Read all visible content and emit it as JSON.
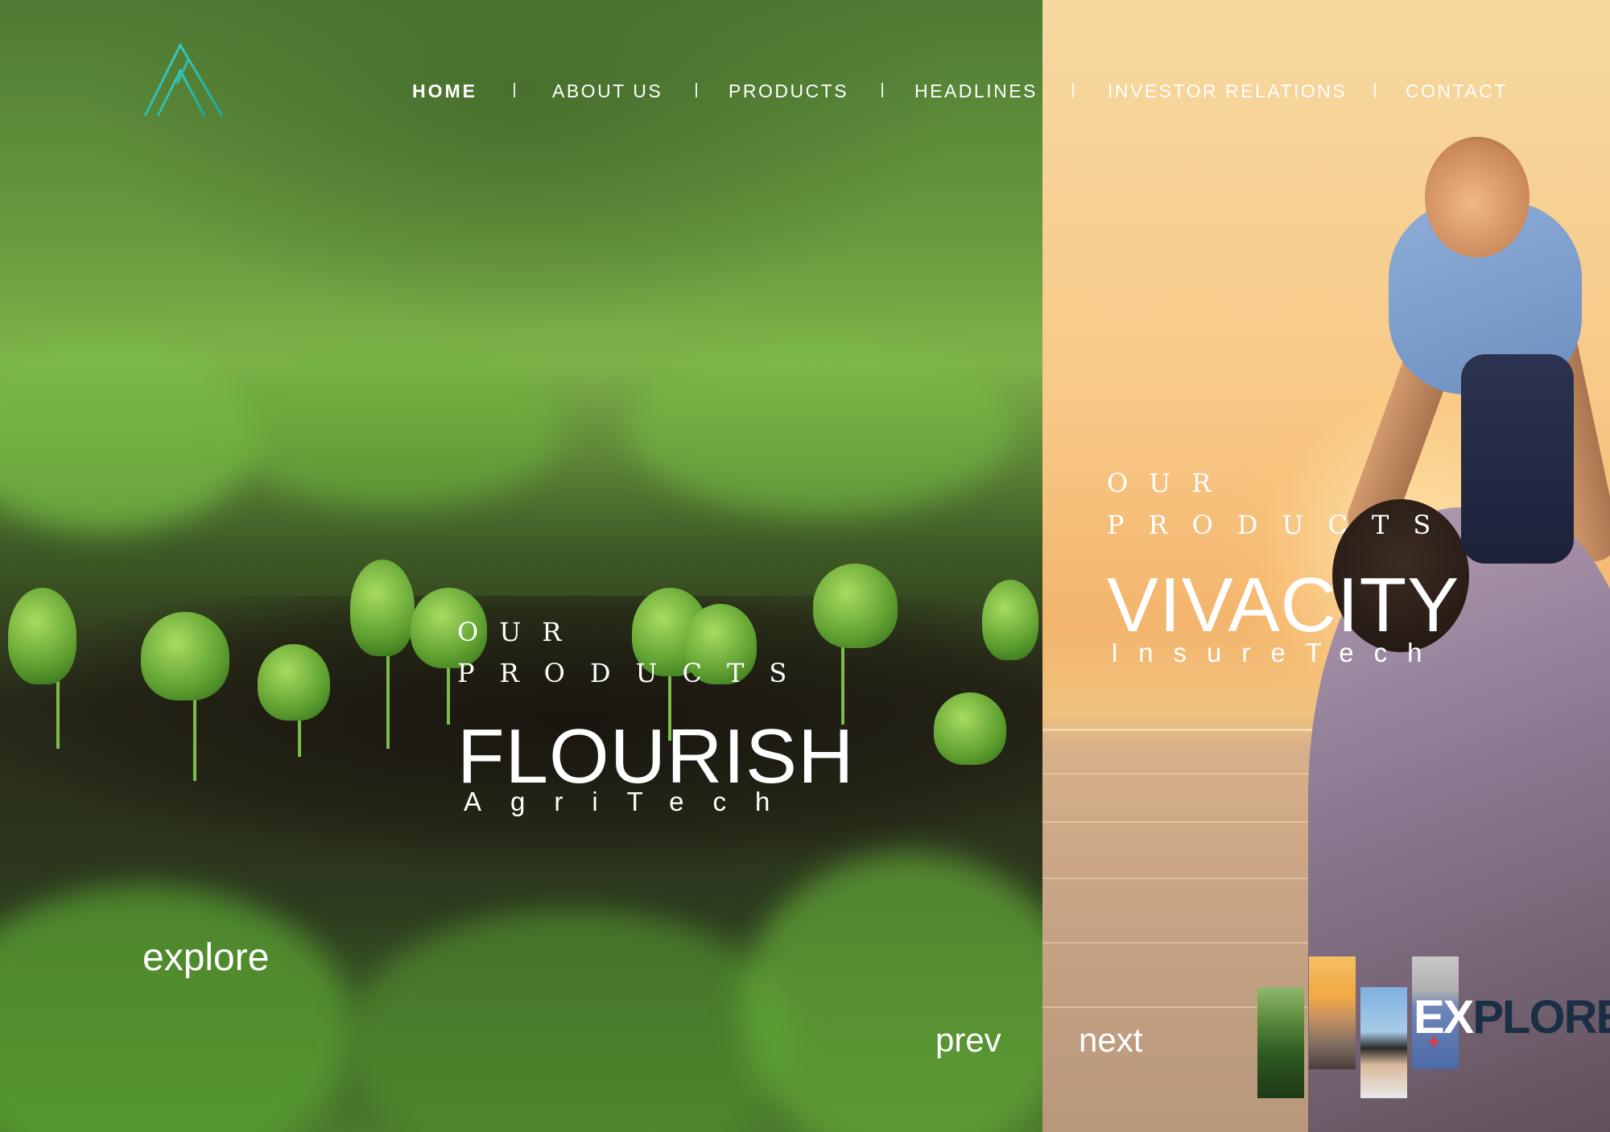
{
  "brand": {
    "logo_icon": "triangle-a-logo",
    "accent": "#2ec4b6"
  },
  "nav": {
    "items": [
      {
        "label": "HOME",
        "active": true
      },
      {
        "label": "ABOUT US",
        "active": false
      },
      {
        "label": "PRODUCTS",
        "active": false
      },
      {
        "label": "HEADLINES",
        "active": false
      },
      {
        "label": "INVESTOR RELATIONS",
        "active": false
      },
      {
        "label": "CONTACT",
        "active": false
      }
    ]
  },
  "slides": [
    {
      "eyebrow_line1": "OUR",
      "eyebrow_line2": "PRODUCTS",
      "title": "FLOURISH",
      "subtitle": "AgriTech"
    },
    {
      "eyebrow_line1": "OUR",
      "eyebrow_line2": "PRODUCTS",
      "title": "VIVACITY",
      "subtitle": "InsureTech"
    }
  ],
  "controls": {
    "explore": "explore",
    "prev": "prev",
    "next": "next"
  },
  "explore_widget": {
    "word_light": "EX",
    "word_dark": "PLORE",
    "plus": "+"
  }
}
